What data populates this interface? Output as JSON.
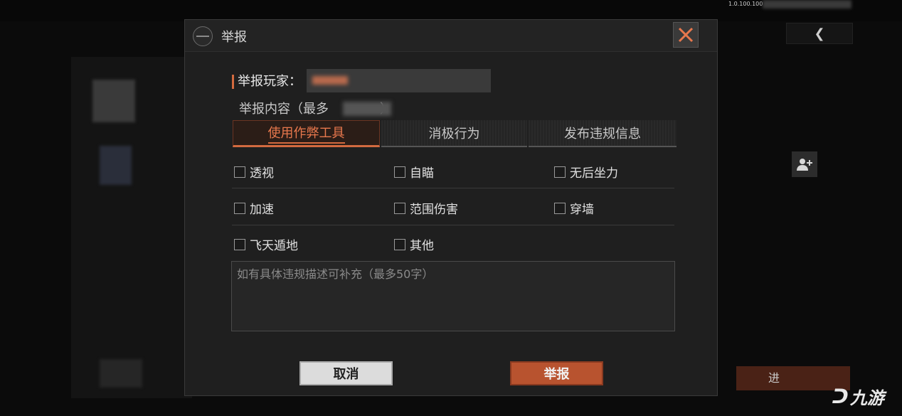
{
  "background": {
    "version": "1.0.100.100",
    "back_icon": "arrow-left-icon",
    "add_friend_icon": "add-friend-icon",
    "button_label": "进",
    "watermark": "九游"
  },
  "modal": {
    "title": "举报",
    "logo_icon": "globe-logo-icon",
    "close_icon": "close-icon",
    "player_label": "举报玩家：",
    "content_label": "举报内容（最多",
    "content_label_end": "）",
    "tabs": [
      {
        "label": "使用作弊工具",
        "active": true
      },
      {
        "label": "消极行为",
        "active": false
      },
      {
        "label": "发布违规信息",
        "active": false
      }
    ],
    "options": [
      {
        "label": "透视",
        "checked": false
      },
      {
        "label": "自瞄",
        "checked": false
      },
      {
        "label": "无后坐力",
        "checked": false
      },
      {
        "label": "加速",
        "checked": false
      },
      {
        "label": "范围伤害",
        "checked": false
      },
      {
        "label": "穿墙",
        "checked": false
      },
      {
        "label": "飞天遁地",
        "checked": false
      },
      {
        "label": "其他",
        "checked": false
      }
    ],
    "description_placeholder": "如有具体违规描述可补充（最多50字）",
    "cancel_label": "取消",
    "report_label": "举报",
    "colors": {
      "accent": "#d36a3f",
      "report_button": "#b8532f",
      "panel": "#1f1f1f"
    }
  }
}
